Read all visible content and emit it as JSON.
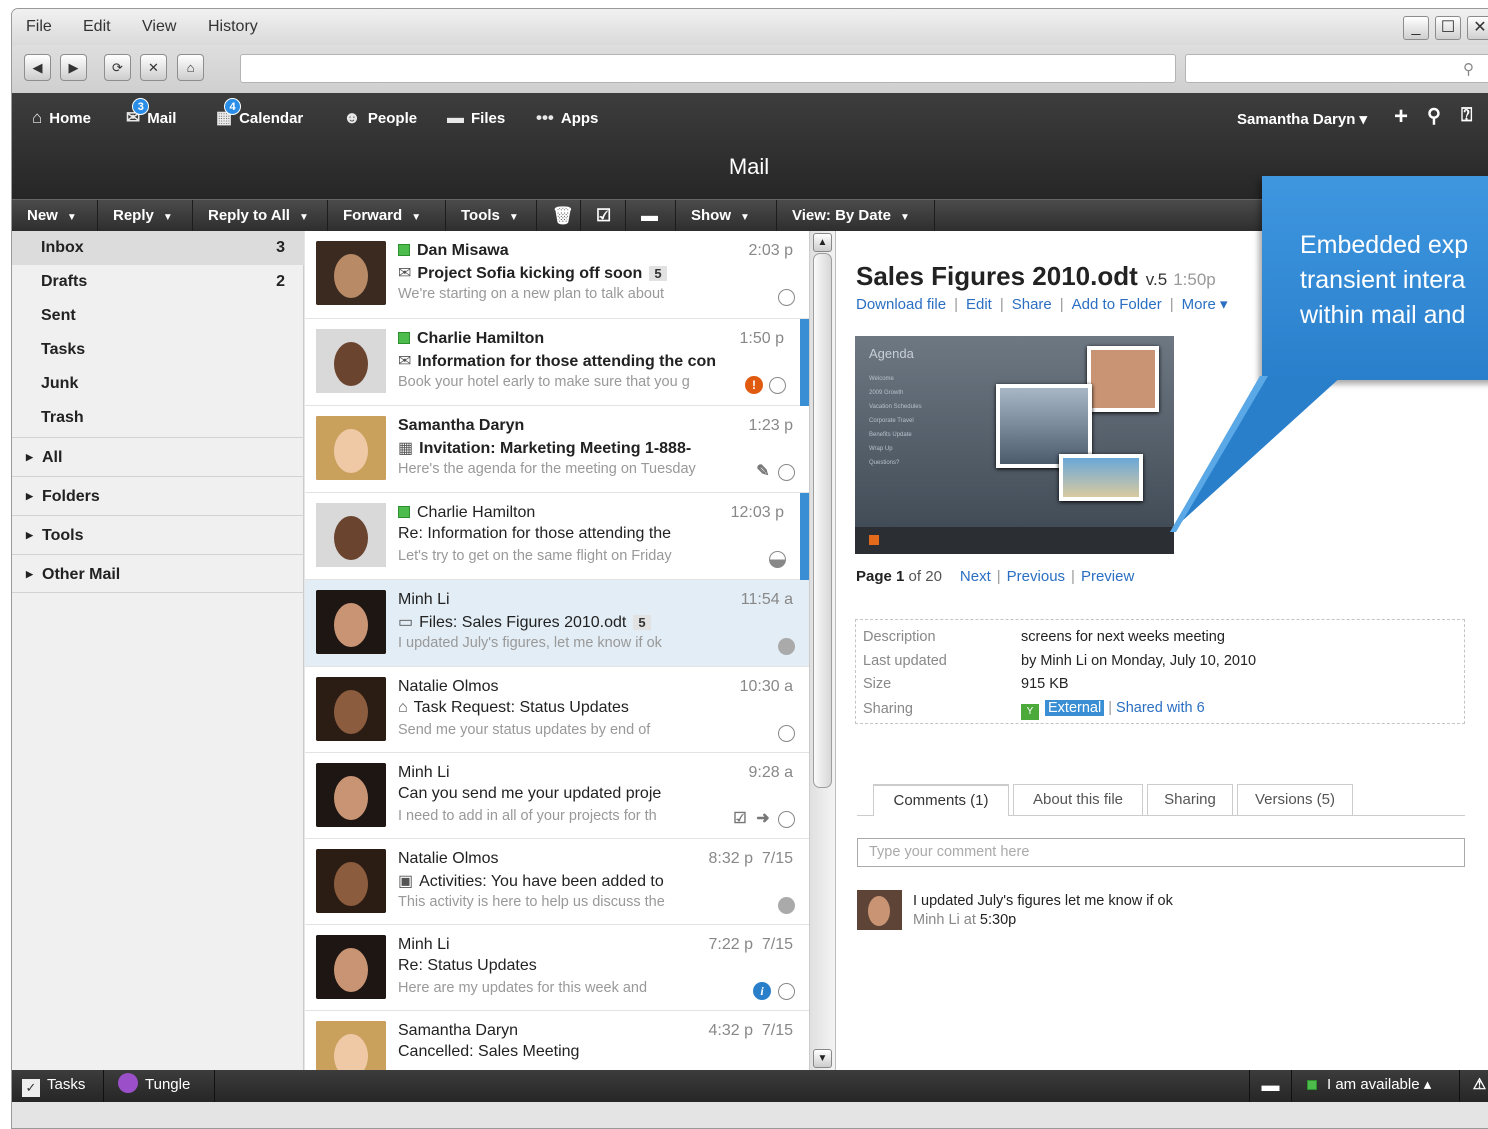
{
  "menu": {
    "file": "File",
    "edit": "Edit",
    "view": "View",
    "history": "History"
  },
  "appnav": {
    "home": "Home",
    "mail": "Mail",
    "mail_badge": "3",
    "calendar": "Calendar",
    "calendar_badge": "4",
    "people": "People",
    "files": "Files",
    "apps": "Apps",
    "user": "Samantha Daryn ▾"
  },
  "app_title": "Mail",
  "toolbar": {
    "new": "New",
    "reply": "Reply",
    "reply_all": "Reply to All",
    "forward": "Forward",
    "tools": "Tools",
    "show": "Show",
    "view": "View: By Date"
  },
  "sidebar": {
    "inbox": "Inbox",
    "inbox_count": "3",
    "drafts": "Drafts",
    "drafts_count": "2",
    "sent": "Sent",
    "tasks": "Tasks",
    "junk": "Junk",
    "trash": "Trash",
    "all": "All",
    "folders": "Folders",
    "tools": "Tools",
    "other_mail": "Other Mail"
  },
  "messages": [
    {
      "from": "Dan Misawa",
      "time": "2:03 p",
      "subject": "Project Sofia kicking off soon",
      "count": "5",
      "preview": "We're starting on a new plan to talk about"
    },
    {
      "from": "Charlie Hamilton",
      "time": "1:50 p",
      "subject": "Information for those attending the con",
      "preview": "Book your hotel early to make sure that you g"
    },
    {
      "from": "Samantha Daryn",
      "time": "1:23 p",
      "subject": "Invitation: Marketing Meeting 1-888-",
      "preview": "Here's the agenda for the meeting on Tuesday"
    },
    {
      "from": "Charlie Hamilton",
      "time": "12:03 p",
      "subject": "Re: Information for those attending the",
      "preview": "Let's try to get on the same flight on Friday"
    },
    {
      "from": "Minh Li",
      "time": "11:54 a",
      "subject": "Files: Sales Figures 2010.odt",
      "count": "5",
      "preview": "I updated July's figures, let me know if ok"
    },
    {
      "from": "Natalie Olmos",
      "time": "10:30 a",
      "subject": "Task Request: Status Updates",
      "preview": "Send me your status updates by end of"
    },
    {
      "from": "Minh Li",
      "time": "9:28 a",
      "subject": "Can you send me your updated proje",
      "preview": "I need to add in all of your projects for th"
    },
    {
      "from": "Natalie Olmos",
      "time": "8:32 p  7/15",
      "subject": "Activities: You have been added to",
      "preview": "This activity is here to help us discuss the"
    },
    {
      "from": "Minh Li",
      "time": "7:22 p  7/15",
      "subject": "Re: Status Updates",
      "preview": "Here are my updates for this week and"
    },
    {
      "from": "Samantha Daryn",
      "time": "4:32 p  7/15",
      "subject": "Cancelled: Sales Meeting",
      "preview": ""
    }
  ],
  "file": {
    "title": "Sales Figures 2010.odt",
    "version": "v.5",
    "time": "1:50p",
    "links": {
      "download": "Download file",
      "edit": "Edit",
      "share": "Share",
      "add": "Add to Folder",
      "more": "More ▾"
    },
    "thumb": {
      "agenda": "Agenda",
      "lines": [
        "Welcome",
        "2009 Growth",
        "Vacation Schedules",
        "Corporate Travel",
        "Benefits Update",
        "Wrap Up",
        "Questions?"
      ]
    },
    "pager": {
      "page": "Page",
      "num": "1",
      "of": "of 20",
      "next": "Next",
      "previous": "Previous",
      "preview": "Preview"
    },
    "meta": {
      "desc_k": "Description",
      "desc_v": "screens for next weeks meeting",
      "upd_k": "Last updated",
      "upd_v": "by Minh Li on Monday, July 10, 2010",
      "size_k": "Size",
      "size_v": "915 KB",
      "share_k": "Sharing",
      "share_ext": "External",
      "share_with": "Shared with 6"
    },
    "tabs": {
      "comments": "Comments (1)",
      "about": "About this file",
      "sharing": "Sharing",
      "versions": "Versions (5)"
    },
    "comment_placeholder": "Type your comment here",
    "comment": {
      "text": "I updated July's figures let me know if ok",
      "by": "Minh Li at",
      "time": "5:30p"
    }
  },
  "callout": {
    "line1": "Embedded exp",
    "line2": "transient intera",
    "line3": "within mail and"
  },
  "statusbar": {
    "tasks": "Tasks",
    "tungle": "Tungle",
    "available": "I am available ▴"
  }
}
